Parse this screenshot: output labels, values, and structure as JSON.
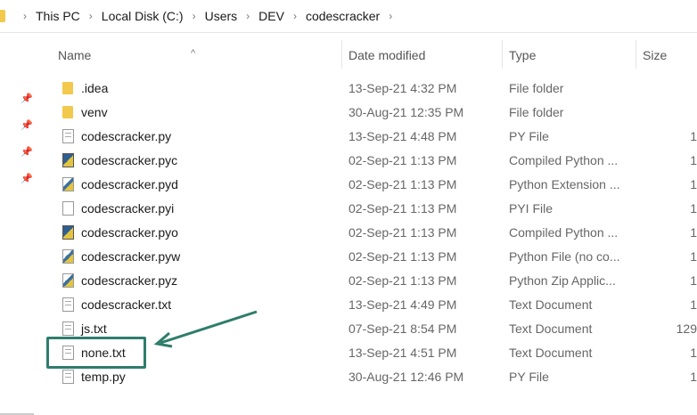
{
  "breadcrumb": [
    "This PC",
    "Local Disk (C:)",
    "Users",
    "DEV",
    "codescracker"
  ],
  "columns": {
    "name": "Name",
    "date": "Date modified",
    "type": "Type",
    "size": "Size"
  },
  "files": [
    {
      "name": ".idea",
      "date": "13-Sep-21 4:32 PM",
      "type": "File folder",
      "size": "",
      "icon": "folder"
    },
    {
      "name": "venv",
      "date": "30-Aug-21 12:35 PM",
      "type": "File folder",
      "size": "",
      "icon": "folder"
    },
    {
      "name": "codescracker.py",
      "date": "13-Sep-21 4:48 PM",
      "type": "PY File",
      "size": "1",
      "icon": "doc"
    },
    {
      "name": "codescracker.pyc",
      "date": "02-Sep-21 1:13 PM",
      "type": "Compiled Python ...",
      "size": "1",
      "icon": "pyc"
    },
    {
      "name": "codescracker.pyd",
      "date": "02-Sep-21 1:13 PM",
      "type": "Python Extension ...",
      "size": "1",
      "icon": "pyd"
    },
    {
      "name": "codescracker.pyi",
      "date": "02-Sep-21 1:13 PM",
      "type": "PYI File",
      "size": "1",
      "icon": "blank"
    },
    {
      "name": "codescracker.pyo",
      "date": "02-Sep-21 1:13 PM",
      "type": "Compiled Python ...",
      "size": "1",
      "icon": "pyc"
    },
    {
      "name": "codescracker.pyw",
      "date": "02-Sep-21 1:13 PM",
      "type": "Python File (no co...",
      "size": "1",
      "icon": "pyd"
    },
    {
      "name": "codescracker.pyz",
      "date": "02-Sep-21 1:13 PM",
      "type": "Python Zip Applic...",
      "size": "1",
      "icon": "pyd"
    },
    {
      "name": "codescracker.txt",
      "date": "13-Sep-21 4:49 PM",
      "type": "Text Document",
      "size": "1",
      "icon": "doc"
    },
    {
      "name": "js.txt",
      "date": "07-Sep-21 8:54 PM",
      "type": "Text Document",
      "size": "129",
      "icon": "doc"
    },
    {
      "name": "none.txt",
      "date": "13-Sep-21 4:51 PM",
      "type": "Text Document",
      "size": "1",
      "icon": "doc"
    },
    {
      "name": "temp.py",
      "date": "30-Aug-21 12:46 PM",
      "type": "PY File",
      "size": "1",
      "icon": "doc"
    }
  ],
  "highlight_color": "#2e7d6b"
}
